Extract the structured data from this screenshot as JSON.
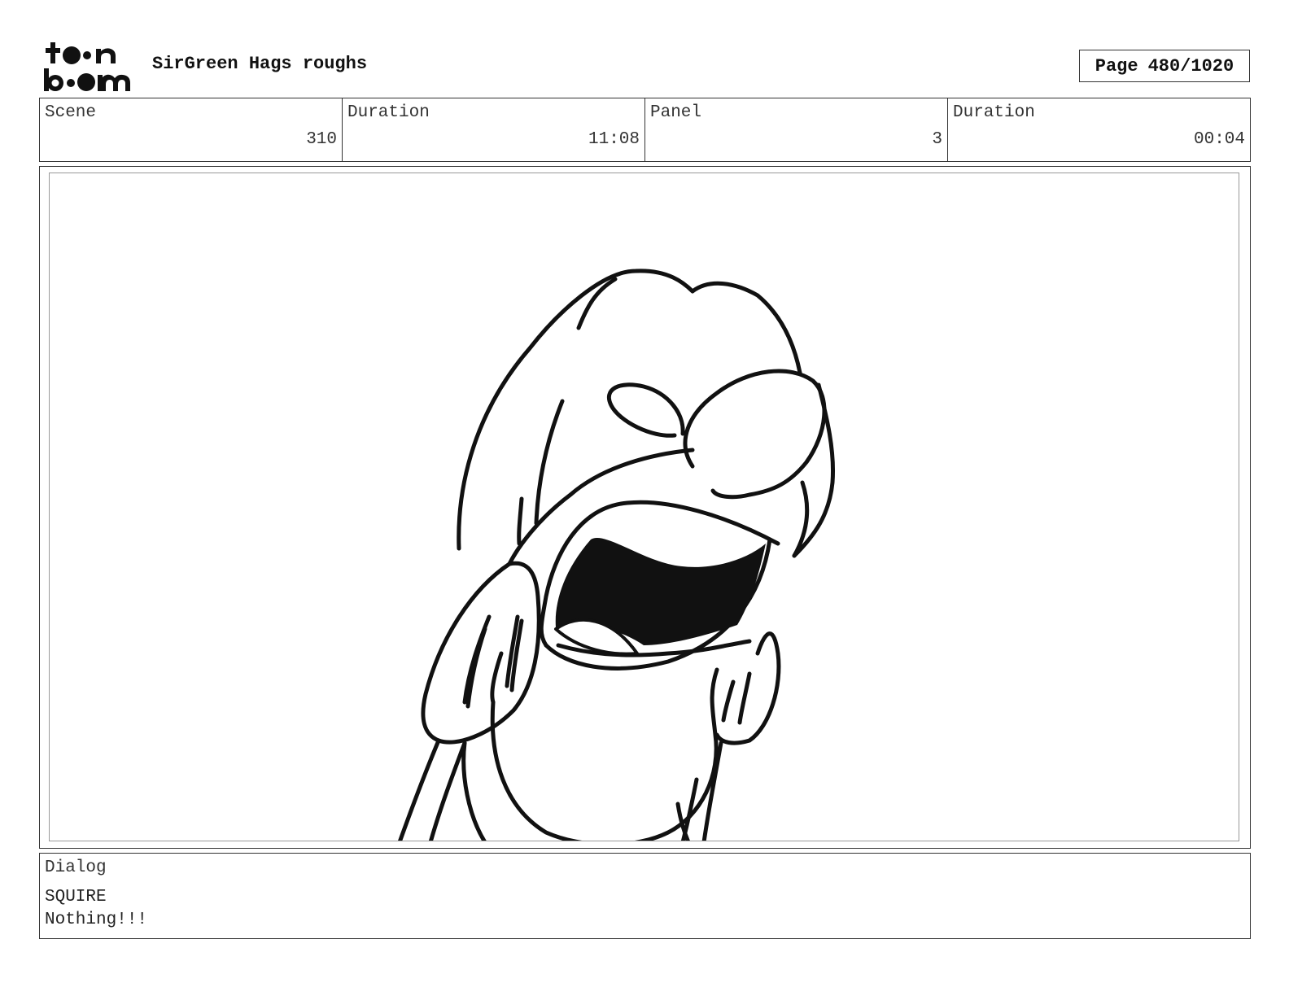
{
  "header": {
    "logo": {
      "icon": "toon-boom-logo",
      "line1": "toon",
      "line2": "boom"
    },
    "project_title": "SirGreen Hags roughs",
    "page_label": "Page",
    "page_number": "480/1020"
  },
  "info": {
    "scene_label": "Scene",
    "scene_value": "310",
    "scene_duration_label": "Duration",
    "scene_duration_value": "11:08",
    "panel_label": "Panel",
    "panel_value": "3",
    "panel_duration_label": "Duration",
    "panel_duration_value": "00:04"
  },
  "panel": {
    "image": "character-sketch-screaming"
  },
  "dialog": {
    "label": "Dialog",
    "speaker": "SQUIRE",
    "line": "Nothing!!!"
  }
}
